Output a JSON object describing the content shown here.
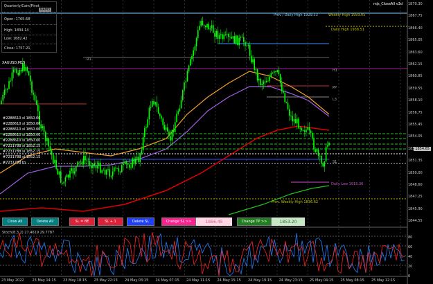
{
  "colors": {
    "bg": "#000000",
    "candle": "#00ff00",
    "ma_orange": "#f0a030",
    "ma_violet": "#a060e0",
    "ma_red": "#e00000",
    "ma_green": "#20c020",
    "ma_blue": "#3050ff",
    "grid": "#303030"
  },
  "header": {
    "symbol": "XAUUSD,M15",
    "ea_name": "mjs_CloseAll v3d",
    "period_badge": "RAM3"
  },
  "info_panel": {
    "title": "Quarterly/Cam/Pivot",
    "open": "Open: 1765.68",
    "high": "High: 1834.14",
    "low": "Low: 1682.42",
    "close": "Close: 1757.21"
  },
  "price_axis": [
    "1870.30",
    "1867.75",
    "1866.40",
    "1865.05",
    "1863.60",
    "1862.15",
    "1860.85",
    "1859.55",
    "1858.10",
    "1856.75",
    "1855.45",
    "1854.05",
    "1852.65",
    "1851.35",
    "1850.00",
    "1848.60",
    "1847.25",
    "1845.90",
    "1844.55"
  ],
  "current_price": "1854.65",
  "time_axis": [
    "23 May 2022",
    "23 May 14:15",
    "23 May 18:15",
    "23 May 22:15",
    "24 May 03:15",
    "24 May 07:15",
    "24 May 11:15",
    "24 May 15:15",
    "24 May 19:15",
    "24 May 23:15",
    "25 May 04:15",
    "25 May 08:15",
    "25 May 12:15"
  ],
  "levels": {
    "prev_daily_high": "Prev / Daily High 1929.33",
    "weekly_high": "Weekly High 1959.05",
    "daily_high": "Daily High 1938.51",
    "h1": "H1",
    "pp": "PP",
    "l3": "L3",
    "r1": "R1",
    "s1": "S1",
    "daily_low": "Daily Low 1915.36",
    "prev_weekly_high": "Prev. Weekly High 1836.62"
  },
  "order_tags": [
    "#2288610 sl 1850.00",
    "#2288610 sl 1850.00",
    "#2288610 sl 1850.00",
    "#2288610 sl 1850.00",
    "#2288610 sl 1850.00",
    "#7231788 sl 1852.15",
    "#7231788 sl 1852.15",
    "#7231788 sl 1852.15",
    "#7231788 tp"
  ],
  "buttons": {
    "close_all": "Close All",
    "delete_all": "Delete All",
    "sl_be": "SL = BE",
    "sl_plus": "SL + 1",
    "delete_sl": "Delete SL",
    "change_sl": "Change SL >>",
    "change_tp": "Change TP >>"
  },
  "fields": {
    "sl_value": "1856.45",
    "tp_value": "1853.20"
  },
  "stoch": {
    "title": "Stoch(8,3,2) 27.4619 29.7787",
    "levels": [
      "80",
      "60",
      "40",
      "20",
      "0"
    ]
  }
}
